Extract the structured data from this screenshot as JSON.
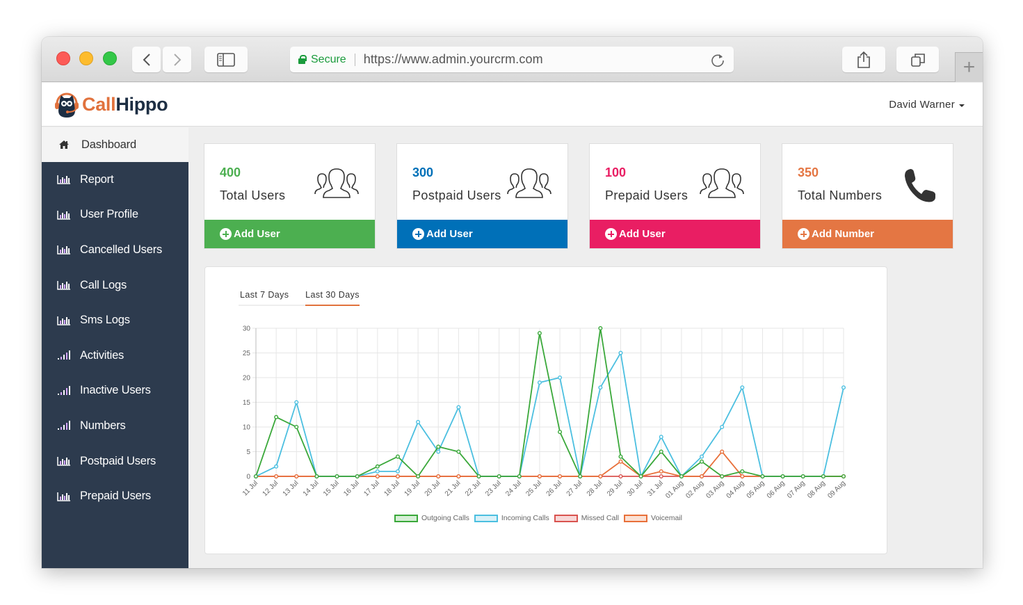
{
  "browser": {
    "secure_label": "Secure",
    "url": "https://www.admin.yourcrm.com",
    "newtab_symbol": "+"
  },
  "app": {
    "logo_part1": "Call",
    "logo_part2": "Hippo",
    "user_name": "David Warner"
  },
  "sidebar": {
    "items": [
      {
        "label": "Dashboard",
        "icon": "home-icon",
        "active": true
      },
      {
        "label": "Report",
        "icon": "bar-chart-icon"
      },
      {
        "label": "User Profile",
        "icon": "bar-chart-icon"
      },
      {
        "label": "Cancelled Users",
        "icon": "bar-chart-icon"
      },
      {
        "label": "Call Logs",
        "icon": "bar-chart-icon"
      },
      {
        "label": "Sms Logs",
        "icon": "bar-chart-icon"
      },
      {
        "label": "Activities",
        "icon": "signal-icon"
      },
      {
        "label": "Inactive Users",
        "icon": "signal-icon"
      },
      {
        "label": "Numbers",
        "icon": "signal-icon"
      },
      {
        "label": "Postpaid Users",
        "icon": "bar-chart-icon"
      },
      {
        "label": "Prepaid Users",
        "icon": "bar-chart-icon"
      }
    ]
  },
  "cards": [
    {
      "value": "400",
      "label": "Total Users",
      "action": "Add User",
      "color": "#4caf50",
      "icon": "users-icon"
    },
    {
      "value": "300",
      "label": "Postpaid Users",
      "action": "Add User",
      "color": "#0070b8",
      "icon": "users-icon"
    },
    {
      "value": "100",
      "label": "Prepaid Users",
      "action": "Add User",
      "color": "#e91e63",
      "icon": "users-icon"
    },
    {
      "value": "350",
      "label": "Total Numbers",
      "action": "Add Number",
      "color": "#e47643",
      "icon": "phone-icon"
    }
  ],
  "chart_tabs": {
    "tab1": "Last 7 Days",
    "tab2": "Last 30 Days",
    "active": "Last 30 Days"
  },
  "chart_data": {
    "type": "line",
    "title": "",
    "xlabel": "",
    "ylabel": "",
    "ylim": [
      0,
      30
    ],
    "yticks": [
      0,
      5,
      10,
      15,
      20,
      25,
      30
    ],
    "grid": true,
    "legend_position": "bottom",
    "categories": [
      "11 Jul",
      "12 Jul",
      "13 Jul",
      "14 Jul",
      "15 Jul",
      "16 Jul",
      "17 Jul",
      "18 Jul",
      "19 Jul",
      "20 Jul",
      "21 Jul",
      "22 Jul",
      "23 Jul",
      "24 Jul",
      "25 Jul",
      "26 Jul",
      "27 Jul",
      "28 Jul",
      "29 Jul",
      "30 Jul",
      "31 Jul",
      "01 Aug",
      "02 Aug",
      "03 Aug",
      "04 Aug",
      "05 Aug",
      "06 Aug",
      "07 Aug",
      "08 Aug",
      "09 Aug"
    ],
    "series": [
      {
        "name": "Missed Call",
        "color": "#d9534f",
        "fill": "#f8d7d7",
        "values": [
          0,
          0,
          0,
          0,
          0,
          0,
          0,
          0,
          0,
          0,
          0,
          0,
          0,
          0,
          0,
          0,
          0,
          0,
          0,
          0,
          0,
          0,
          0,
          0,
          0,
          0,
          0,
          0,
          0,
          0
        ]
      },
      {
        "name": "Voicemail",
        "color": "#e8703a",
        "fill": "#fbe0d3",
        "values": [
          0,
          0,
          0,
          0,
          0,
          0,
          0,
          0,
          0,
          0,
          0,
          0,
          0,
          0,
          0,
          0,
          0,
          0,
          3,
          0,
          1,
          0,
          0,
          5,
          0,
          0,
          0,
          0,
          0,
          0
        ]
      },
      {
        "name": "Incoming Calls",
        "color": "#4bbfe0",
        "fill": "#d9f1f8",
        "values": [
          0,
          2,
          15,
          0,
          0,
          0,
          1,
          1,
          11,
          5,
          14,
          0,
          0,
          0,
          19,
          20,
          0,
          18,
          25,
          0,
          8,
          0,
          4,
          10,
          18,
          0,
          0,
          0,
          0,
          18
        ]
      },
      {
        "name": "Outgoing Calls",
        "color": "#3aa83a",
        "fill": "#d6efd6",
        "values": [
          0,
          12,
          10,
          0,
          0,
          0,
          2,
          4,
          0,
          6,
          5,
          0,
          0,
          0,
          29,
          9,
          0,
          30,
          4,
          0,
          5,
          0,
          3,
          0,
          1,
          0,
          0,
          0,
          0,
          0
        ]
      }
    ],
    "legend": [
      "Outgoing Calls",
      "Incoming Calls",
      "Missed Call",
      "Voicemail"
    ]
  }
}
